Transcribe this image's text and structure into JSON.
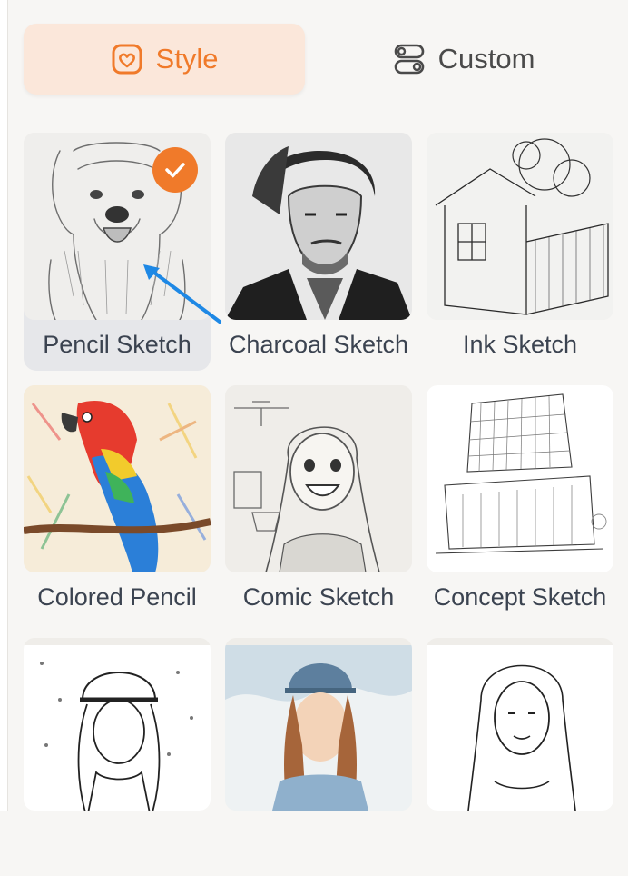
{
  "tabs": {
    "style_label": "Style",
    "custom_label": "Custom",
    "active": "Style"
  },
  "colors": {
    "accent": "#f07a2a",
    "active_tab_bg": "#fbe7da",
    "selected_card_bg": "#e6e7ea",
    "label_text": "#3b4350"
  },
  "styles": [
    {
      "label": "Pencil Sketch",
      "selected": true,
      "icon": "dog-pencil-sketch-image"
    },
    {
      "label": "Charcoal Sketch",
      "selected": false,
      "icon": "man-charcoal-portrait-image"
    },
    {
      "label": "Ink Sketch",
      "selected": false,
      "icon": "house-ink-drawing-image"
    },
    {
      "label": "Colored Pencil",
      "selected": false,
      "icon": "parrot-colored-pencil-image"
    },
    {
      "label": "Comic Sketch",
      "selected": false,
      "icon": "girl-comic-sketch-image"
    },
    {
      "label": "Concept Sketch",
      "selected": false,
      "icon": "building-concept-sketch-image"
    },
    {
      "label": "",
      "selected": false,
      "icon": "girl-beanie-line-art-image"
    },
    {
      "label": "",
      "selected": false,
      "icon": "girl-watercolor-portrait-image"
    },
    {
      "label": "",
      "selected": false,
      "icon": "woman-line-portrait-image"
    }
  ]
}
